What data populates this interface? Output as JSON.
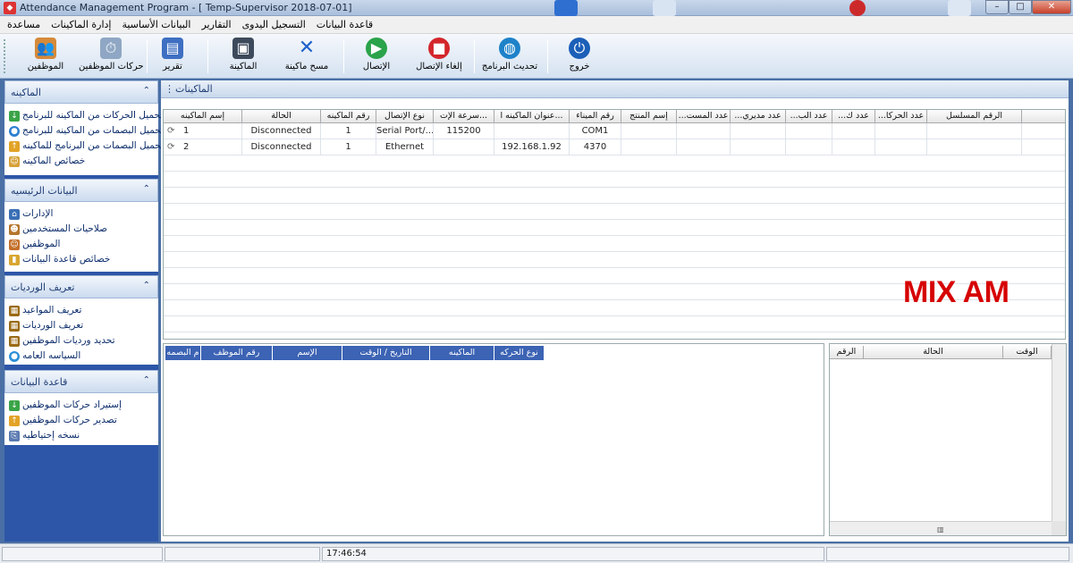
{
  "window": {
    "title": "Attendance Management Program - [ Temp-Supervisor 2018-07-01]"
  },
  "menu": {
    "items": [
      "قاعدة البيانات",
      "التسجيل اليدوى",
      "التقارير",
      "البيانات الأساسية",
      "إدارة الماكينات",
      "مساعدة"
    ]
  },
  "toolbar": {
    "employees": "الموظفين",
    "employee_moves": "حركات الموظفين",
    "report": "تقرير",
    "machine": "الماكينة",
    "clear_machine": "مسح ماكينة",
    "connect": "الإتصال",
    "disconnect": "إلغاء الإتصال",
    "update_program": "تحديث البرنامج",
    "exit": "خروج"
  },
  "sidebar": {
    "groups": [
      {
        "title": "الماكينه",
        "items": [
          {
            "label": "تحميل الحركات من الماكينه للبرنامج",
            "icon": "arrow-down-icon"
          },
          {
            "label": "تحميل البصمات من الماكينه للبرنامج",
            "icon": "globe-icon"
          },
          {
            "label": "تحميل البصمات من البرنامج للماكينه",
            "icon": "arrow-up-icon"
          },
          {
            "label": "خصائص الماكينه",
            "icon": "users-icon"
          }
        ]
      },
      {
        "title": "البيانات الرئيسيه",
        "items": [
          {
            "label": "الإدارات",
            "icon": "building-icon"
          },
          {
            "label": "صلاحيات المستخدمين",
            "icon": "user-key-icon"
          },
          {
            "label": "الموظفين",
            "icon": "users-icon"
          },
          {
            "label": "خصائص قاعدة البيانات",
            "icon": "lock-icon"
          }
        ]
      },
      {
        "title": "تعريف الورديات",
        "items": [
          {
            "label": "تعريف المواعيد",
            "icon": "schedule-icon"
          },
          {
            "label": "تعريف الورديات",
            "icon": "schedule-icon"
          },
          {
            "label": "تحديد ورديات الموظفين",
            "icon": "schedule-icon"
          },
          {
            "label": "السياسه العامه",
            "icon": "globe-icon"
          }
        ]
      },
      {
        "title": "قاعدة البيانات",
        "items": [
          {
            "label": "إستيراد حركات الموظفين",
            "icon": "arrow-down-icon"
          },
          {
            "label": "تصدير حركات الموظفين",
            "icon": "arrow-up-icon"
          },
          {
            "label": "نسخه إحتياطيه",
            "icon": "backup-icon"
          }
        ]
      }
    ]
  },
  "main": {
    "tab_label": "الماكينات",
    "machines_table": {
      "headers": [
        "إسم الماكينه",
        "الحالة",
        "رقم الماكينه",
        "نوع الإتصال",
        "سرعة الإت...",
        "عنوان الماكينه ا...",
        "رقم الميناء",
        "إسم المنتج",
        "...عدد المست",
        "...عدد مديري",
        "...عدد الب",
        "...عدد ك",
        "...عدد الحركا",
        "الرقم المسلسل"
      ],
      "rows": [
        [
          "1",
          "Disconnected",
          "1",
          "Serial Port/...",
          "115200",
          "",
          "COM1",
          "",
          "",
          "",
          "",
          "",
          "",
          ""
        ],
        [
          "2",
          "Disconnected",
          "1",
          "Ethernet",
          "",
          "192.168.1.92",
          "4370",
          "",
          "",
          "",
          "",
          "",
          "",
          ""
        ]
      ]
    },
    "watermark": "MIX AM",
    "log_table": {
      "headers": [
        "م البصمه",
        "رقم الموظف",
        "الإسم",
        "التاريخ / الوقت",
        "الماكينه",
        "نوع الحركه"
      ]
    },
    "status_table": {
      "headers": [
        "الرقم",
        "الحالة",
        "الوقت"
      ]
    }
  },
  "statusbar": {
    "panes": [
      "",
      "",
      "17:46:54",
      ""
    ]
  }
}
